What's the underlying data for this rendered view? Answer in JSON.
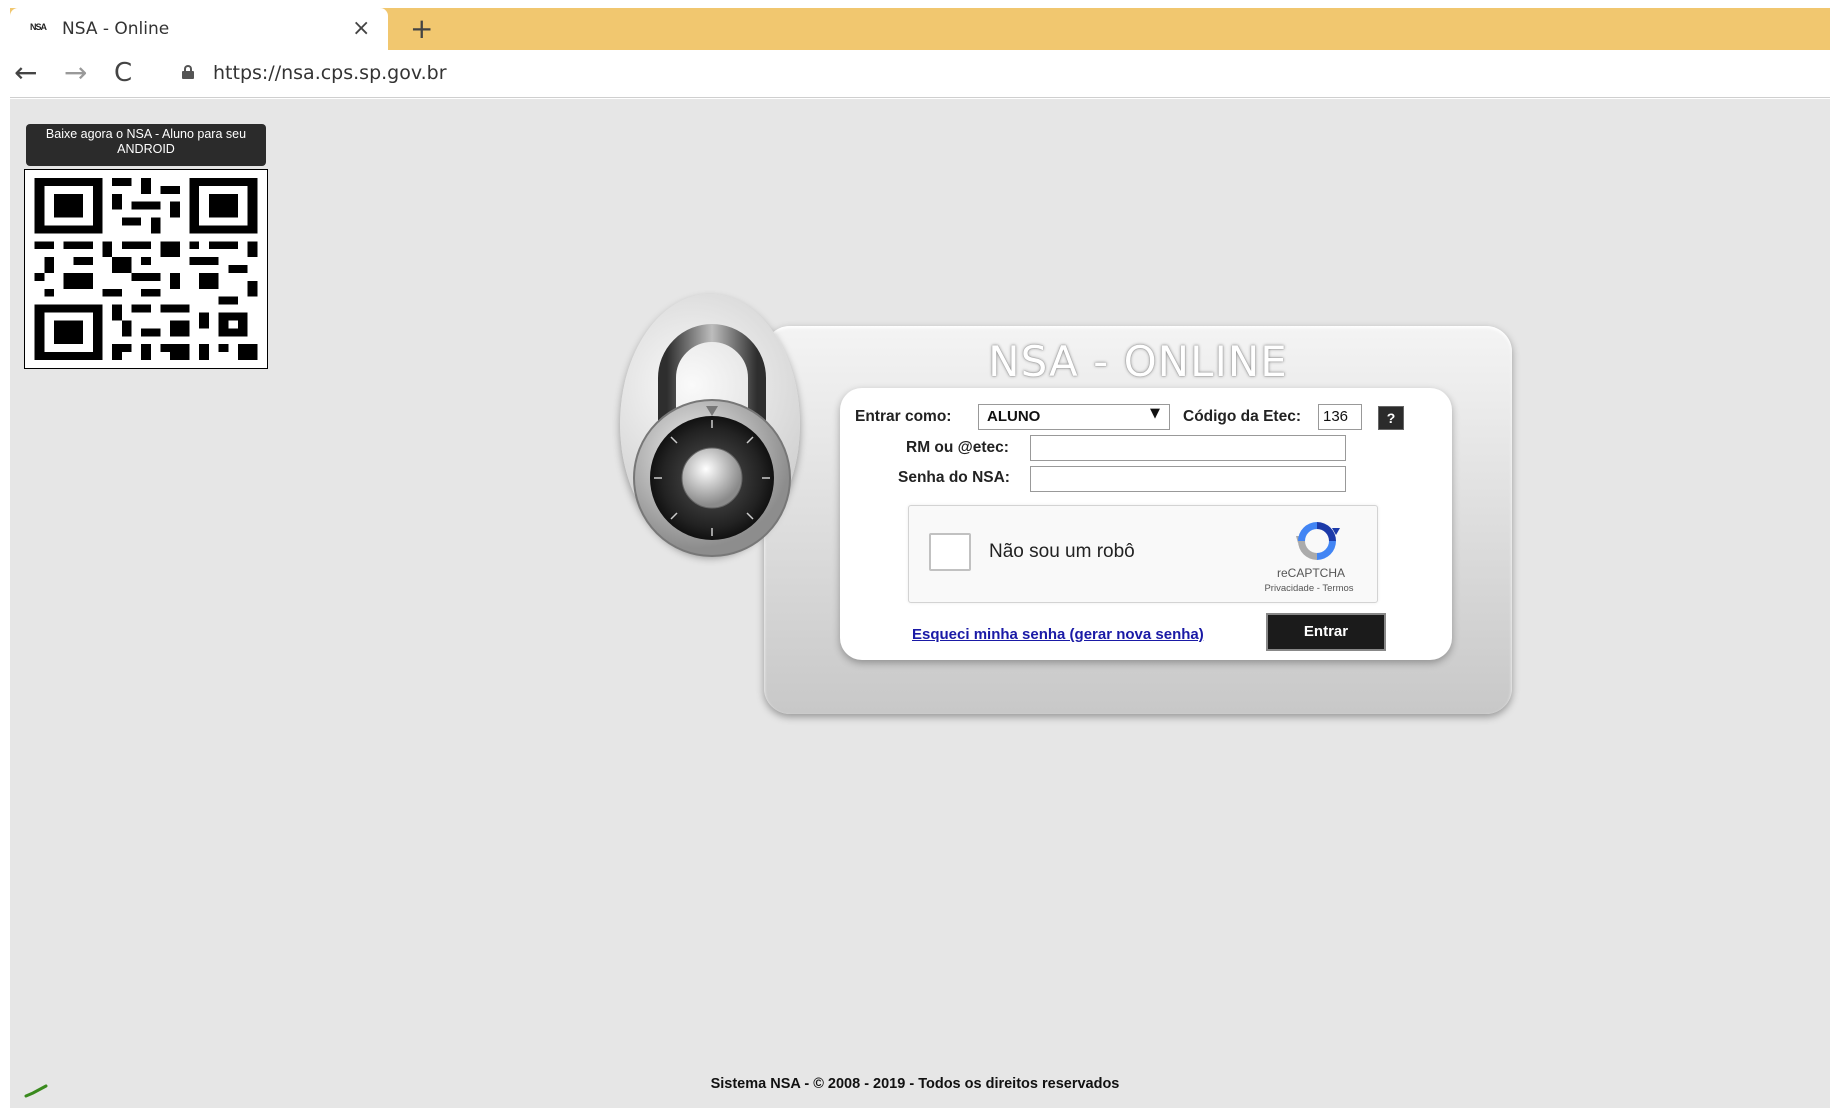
{
  "browser": {
    "tab_title": "NSA - Online",
    "tab_favicon_text": "NSA",
    "close_glyph": "×",
    "new_tab_glyph": "+",
    "back_glyph": "←",
    "forward_glyph": "→",
    "reload_glyph": "C",
    "url": "https://nsa.cps.sp.gov.br",
    "tab_strip_color": "#f1c76f"
  },
  "qr": {
    "caption": "Baixe agora o NSA - Aluno para seu ANDROID"
  },
  "login": {
    "title": "NSA - ONLINE",
    "role_label": "Entrar como:",
    "role_value": "ALUNO",
    "role_arrow": "▼",
    "etec_label": "Código da Etec:",
    "etec_value": "136",
    "help_label": "?",
    "rm_label": "RM ou @etec:",
    "rm_value": "",
    "password_label": "Senha do NSA:",
    "password_value": "",
    "recaptcha_label": "Não sou um robô",
    "recaptcha_brand": "reCAPTCHA",
    "recaptcha_links": "Privacidade - Termos",
    "forgot_link": "Esqueci minha senha (gerar nova senha)",
    "submit_label": "Entrar"
  },
  "footer": {
    "text": "Sistema NSA  -  © 2008 - 2019  -  Todos os direitos reservados"
  },
  "icons": {
    "padlock": "padlock-icon",
    "lock": "lock-icon",
    "recaptcha": "recaptcha-logo-icon",
    "status": "checkmark-icon"
  }
}
